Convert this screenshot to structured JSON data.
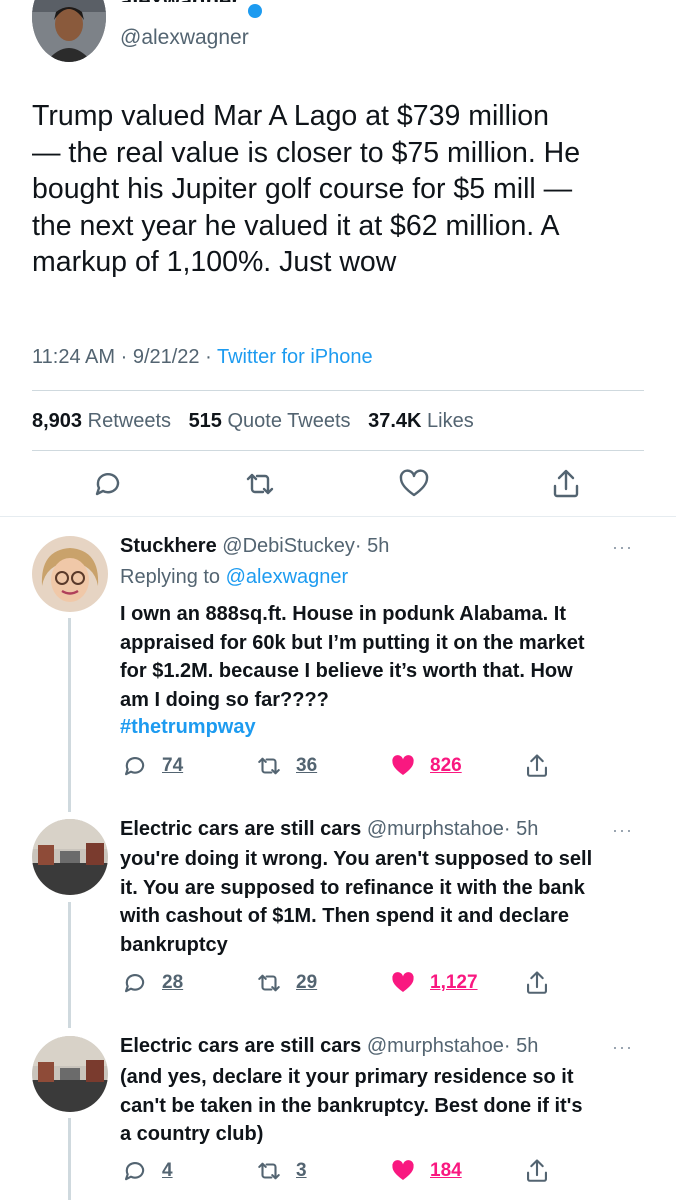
{
  "main_tweet": {
    "name_partial": "alexwagner",
    "handle": "@alexwagner",
    "text": "Trump valued Mar A Lago at $739 million\n— the real value is closer to $75 million. He\nbought his Jupiter golf course for $5 mill —\nthe next year he valued it at $62 million. A\nmarkup of 1,100%. Just wow",
    "time": "11:24 AM",
    "date": "9/21/22",
    "source": "Twitter for iPhone",
    "separator": "·",
    "stats": {
      "retweets_count": "8,903",
      "retweets_label": "Retweets",
      "quotes_count": "515",
      "quotes_label": "Quote Tweets",
      "likes_count": "37.4K",
      "likes_label": "Likes"
    }
  },
  "replies": [
    {
      "name": "Stuckhere",
      "handle": "@DebiStuckey",
      "age": "· 5h",
      "replying_prefix": "Replying to",
      "replying_to": "@alexwagner",
      "text": "I own an 888sq.ft. House in podunk Alabama. It\nappraised for 60k but I’m putting it on the market\nfor $1.2M. because I believe it’s worth that. How\nam I doing so far????",
      "hashtag": "#thetrumpway",
      "replies": "74",
      "retweets": "36",
      "likes": "826",
      "more": "···"
    },
    {
      "name": "Electric cars are still cars",
      "handle": "@murphstahoe",
      "age": "· 5h",
      "text": "you're doing it wrong. You aren't supposed to sell\nit. You are supposed to refinance it with the bank\nwith cashout of $1M. Then spend it and declare\nbankruptcy",
      "replies": "28",
      "retweets": "29",
      "likes": "1,127",
      "more": "···"
    },
    {
      "name": "Electric cars are still cars",
      "handle": "@murphstahoe",
      "age": "· 5h",
      "text": "(and yes, declare it your primary residence so it\ncan't be taken in the bankruptcy. Best done if it's\na country club)",
      "replies": "4",
      "retweets": "3",
      "likes": "184",
      "more": "···"
    }
  ],
  "colors": {
    "accent": "#1d9bf0",
    "like": "#f91880",
    "muted": "#536471",
    "text": "#0f1419"
  }
}
